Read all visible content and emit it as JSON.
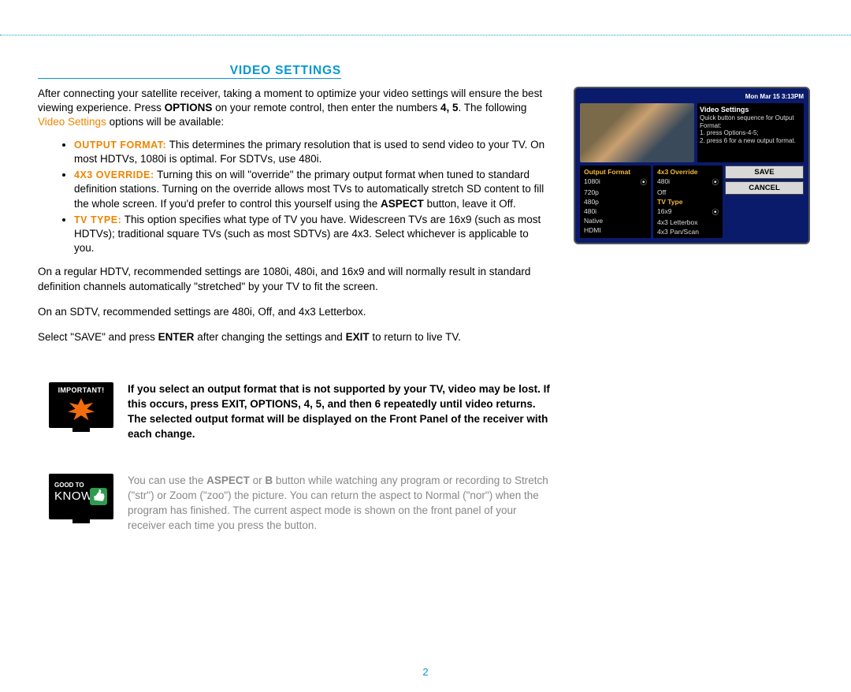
{
  "section_title": "VIDEO SETTINGS",
  "intro": {
    "p1a": "After connecting your satellite receiver, taking a moment to optimize your video settings will ensure the best viewing experience.  Press ",
    "p1b": "OPTIONS",
    "p1c": " on your remote control, then enter the numbers ",
    "p1d": "4, 5",
    "p1e": ".  The following ",
    "p1f": "Video Settings",
    "p1g": " options will be available:"
  },
  "bullets": {
    "b1_label": "OUTPUT FORMAT:",
    "b1_text": " This determines the primary resolution that is used to send video to your TV.  On most HDTVs, 1080i is optimal.  For SDTVs, use 480i.",
    "b2_label": "4X3 OVERRIDE:",
    "b2_text_a": " Turning this on will \"override\" the primary output format when tuned to standard definition stations.  Turning on the override allows most TVs to automatically stretch SD content to fill the whole screen.  If you'd prefer to control this yourself using the ",
    "b2_bold": "ASPECT",
    "b2_text_b": " button, leave it Off.",
    "b3_label": "TV TYPE:",
    "b3_text": " This option specifies what type of TV you have.  Widescreen TVs are 16x9 (such as most HDTVs); traditional square TVs (such as most SDTVs) are 4x3.  Select whichever is applicable to you."
  },
  "paras": {
    "p2": "On a regular HDTV, recommended settings are 1080i, 480i, and 16x9 and will normally result in standard definition channels automatically \"stretched\" by your TV to fit the screen.",
    "p3": "On an SDTV, recommended settings are 480i, Off, and 4x3 Letterbox.",
    "p4a": "Select \"SAVE\" and press ",
    "p4b": "ENTER",
    "p4c": " after changing the settings and ",
    "p4d": "EXIT",
    "p4e": " to return to live TV."
  },
  "important_text": "If you select an output format that is not supported by your TV, video may be lost.  If this occurs, press EXIT, OPTIONS, 4, 5, and then 6 repeatedly until video returns.  The selected output format will be displayed on the Front Panel of the receiver with each change.",
  "goodtoknow": {
    "a": "You can use the ",
    "b": "ASPECT",
    "c": " or ",
    "d": "B",
    "e": " button while watching any program or recording to Stretch (\"str\") or Zoom (\"zoo\") the picture.  You can return the aspect to Normal (\"nor\") when the program has finished.  The current aspect mode is shown on the front panel of your receiver each time you press the button."
  },
  "tv": {
    "date": "Mon Mar 15 3:13PM",
    "title": "Video Settings",
    "sub1": "Quick button sequence for Output Format:",
    "sub2": "1. press Options-4-5;",
    "sub3": "2. press 6 for a new output format.",
    "col1_hdr": "Output Format",
    "col1": [
      "1080i",
      "720p",
      "480p",
      "480i",
      "Native",
      "HDMI"
    ],
    "col2_hdr": "4x3 Override",
    "col2a": "480i",
    "col2b": "Off",
    "col2_hdr2": "TV Type",
    "col2c": "16x9",
    "col2d": "4x3 Letterbox",
    "col2e": "4x3 Pan/Scan",
    "save": "SAVE",
    "cancel": "CANCEL"
  },
  "icons": {
    "good_to": "GOOD TO",
    "know": "KNOW"
  },
  "page_number": "2"
}
